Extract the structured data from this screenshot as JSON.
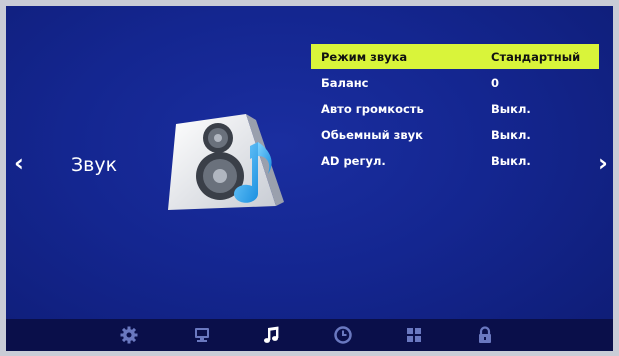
{
  "screen": {
    "section_title": "Звук",
    "nav": {
      "left_arrow": "‹",
      "right_arrow": "›"
    }
  },
  "menu": {
    "items": [
      {
        "label": "Режим звука",
        "value": "Стандартный",
        "selected": true
      },
      {
        "label": "Баланс",
        "value": "0",
        "selected": false
      },
      {
        "label": "Авто громкость",
        "value": "Выкл.",
        "selected": false
      },
      {
        "label": "Обьемный звук",
        "value": "Выкл.",
        "selected": false
      },
      {
        "label": "AD регул.",
        "value": "Выкл.",
        "selected": false
      }
    ]
  },
  "bottom_tabs": [
    {
      "icon": "gear-icon",
      "active": false
    },
    {
      "icon": "monitor-icon",
      "active": false
    },
    {
      "icon": "music-note-icon",
      "active": true
    },
    {
      "icon": "clock-icon",
      "active": false
    },
    {
      "icon": "grid-icon",
      "active": false
    },
    {
      "icon": "lock-icon",
      "active": false
    }
  ],
  "colors": {
    "background": "#142690",
    "highlight": "#d9f43a",
    "inactive_icon": "#6a78c0",
    "active_icon": "#ffffff"
  }
}
